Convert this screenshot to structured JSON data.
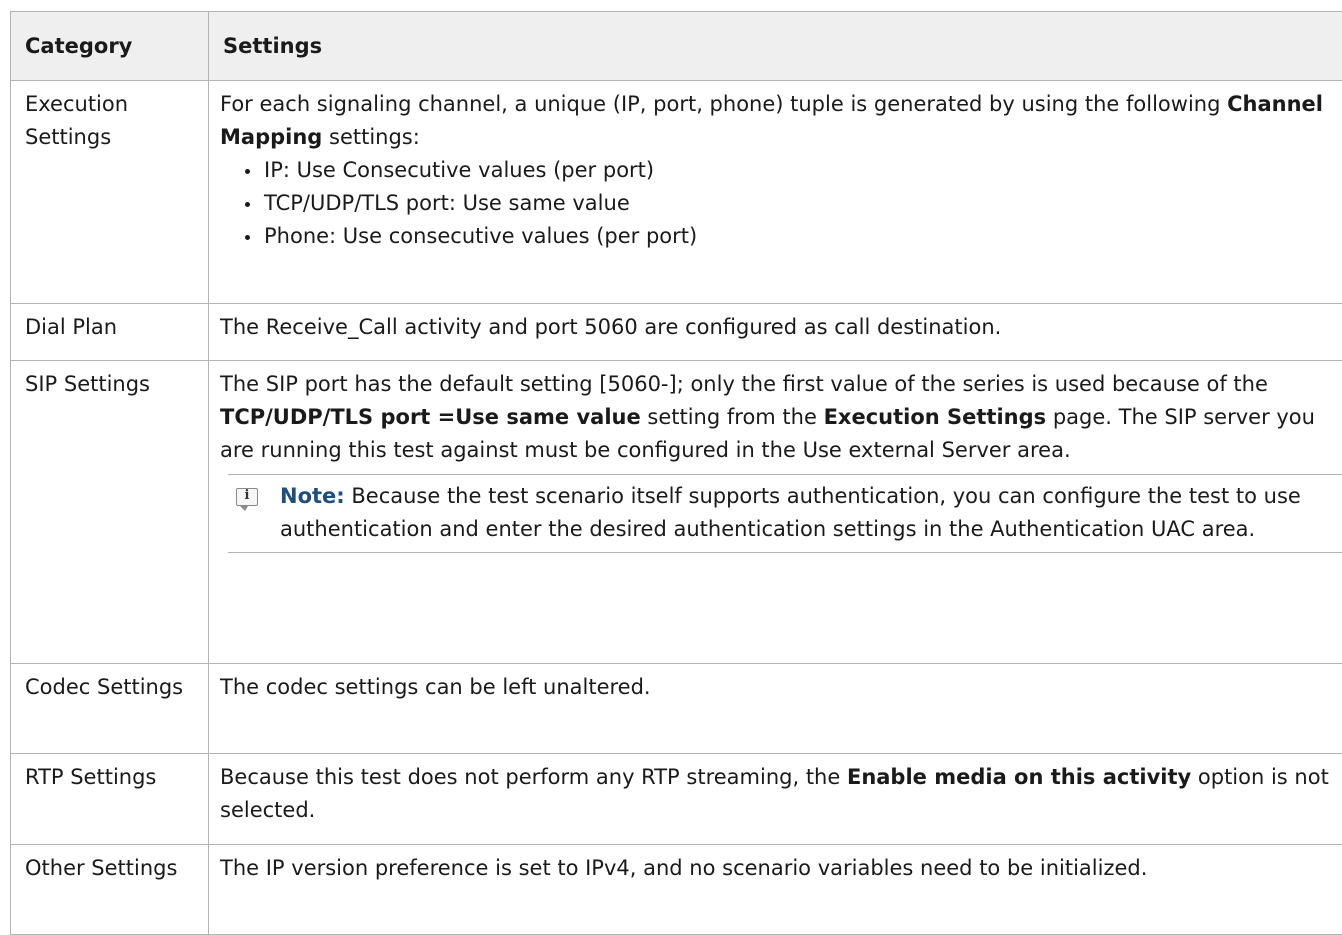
{
  "table": {
    "headers": {
      "category": "Category",
      "settings": "Settings"
    },
    "rows": [
      {
        "category": "Execution Settings",
        "text_before": "For each signaling channel, a unique (IP, port, phone) tuple is generated by using the following ",
        "text_bold": "Channel Mapping",
        "text_after": " settings:",
        "bullets": [
          "IP: Use Consecutive values (per port)",
          "TCP/UDP/TLS port: Use same value",
          "Phone: Use consecutive values (per port)"
        ]
      },
      {
        "category": "Dial Plan",
        "text": "The Receive_Call activity and port 5060 are configured as call destination."
      },
      {
        "category": "SIP Settings",
        "text_1": "The SIP port has the default setting [5060-]; only the first value of the series is used because of the ",
        "bold_1": "TCP/UDP/TLS port =Use same value",
        "text_2": " setting from the ",
        "bold_2": "Execution Settings",
        "text_3": " page. The SIP server you are running this test against must be configured in the Use external Server area.",
        "note_label": "Note:",
        "note_text": " Because the test scenario itself supports authentication, you can configure the test to use authentication and enter the desired authentication settings in the Authentication UAC area.",
        "note_icon_glyph": "i"
      },
      {
        "category": "Codec Settings",
        "text": "The codec settings can be left unaltered."
      },
      {
        "category": "RTP Settings",
        "text_1": "Because this test does not perform any RTP streaming, the ",
        "bold_1": "Enable media on this activity",
        "text_2": " option is not selected."
      },
      {
        "category": "Other Settings",
        "text": "The IP version preference is set to IPv4, and no scenario variables need to be initialized."
      }
    ]
  },
  "colors": {
    "header_background": "#efefef",
    "border": "#b3b3b3",
    "note_label": "#1f4e79",
    "text": "#1a1a1a"
  },
  "icons": {
    "note": "info-note-icon"
  }
}
